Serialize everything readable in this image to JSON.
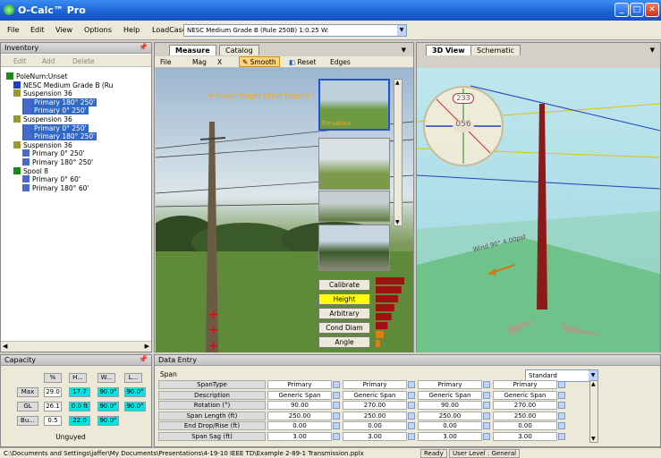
{
  "window": {
    "title": "O-Calc™ Pro"
  },
  "menubar": {
    "items": [
      "File",
      "Edit",
      "View",
      "Options",
      "Help"
    ],
    "loadcase_label": "LoadCase:",
    "loadcase_value": "NESC Medium Grade B (Rule 250B) 1:0.25 W:"
  },
  "inventory": {
    "title": "Inventory",
    "toolbar": {
      "edit": "Edit",
      "add": "Add",
      "delete": "Delete"
    },
    "tree": [
      {
        "label": "PoleNum:Unset",
        "icon": "pole-icon"
      },
      {
        "label": "NESC Medium Grade B (Ru",
        "icon": "info-icon"
      },
      {
        "label": "Suspension 36",
        "icon": "insulator-icon"
      },
      {
        "label": "Primary 180° 250'",
        "icon": "wire-icon",
        "selected": true
      },
      {
        "label": "Primary 0° 250'",
        "icon": "wire-icon",
        "selected": true
      },
      {
        "label": "Suspension 36",
        "icon": "insulator-icon"
      },
      {
        "label": "Primary 0° 250'",
        "icon": "wire-icon",
        "selected": true
      },
      {
        "label": "Primary 180° 250'",
        "icon": "wire-icon",
        "selected": true
      },
      {
        "label": "Suspension 36",
        "icon": "insulator-icon"
      },
      {
        "label": "Primary 0° 250'",
        "icon": "wire-icon"
      },
      {
        "label": "Primary 180° 250'",
        "icon": "wire-icon"
      },
      {
        "label": "Spool 8",
        "icon": "spool-icon"
      },
      {
        "label": "Primary 0° 60'",
        "icon": "wire-icon"
      },
      {
        "label": "Primary 180° 60'",
        "icon": "wire-icon"
      }
    ]
  },
  "capacity": {
    "title": "Capacity",
    "headers": [
      "%",
      "H...",
      "W...",
      "L..."
    ],
    "rows": [
      {
        "label": "Max",
        "values": [
          "29.0",
          "17.7",
          "90.0°",
          "90.0°"
        ]
      },
      {
        "label": "GL",
        "values": [
          "26.1",
          "0.0 ft",
          "90.0°",
          "90.0°"
        ]
      },
      {
        "label": "Bu...",
        "values": [
          "0.5",
          "22.0",
          "90.0°"
        ]
      }
    ],
    "footer": "Unguyed"
  },
  "measure": {
    "tabs": [
      "Measure",
      "Catalog"
    ],
    "toolbar": {
      "file": "File",
      "mag": "Mag",
      "x": "X",
      "smooth": "Smooth",
      "reset": "Reset",
      "edges": "Edges"
    },
    "install_label": "Install Height (ft) of Spool 8",
    "thumb_label": "Elevation",
    "buttons": [
      "Calibrate",
      "Height",
      "Arbitrary",
      "Cond Diam",
      "Angle"
    ],
    "active_button": "Height",
    "bar_fractions": [
      1.0,
      0.9,
      0.78,
      0.65,
      0.55,
      0.42,
      0.28,
      0.15
    ]
  },
  "view3d": {
    "tabs": [
      "3D View",
      "Schematic"
    ],
    "compass": {
      "top": "233",
      "center": "056"
    },
    "wind_label": "Wind 90° 4.00psf"
  },
  "dataentry": {
    "title": "Data Entry",
    "section": "Span",
    "preset": "Standard",
    "rows": [
      {
        "label": "SpanType",
        "values": [
          "Primary",
          "Primary",
          "Primary",
          "Primary"
        ]
      },
      {
        "label": "Description",
        "values": [
          "Generic Span",
          "Generic Span",
          "Generic Span",
          "Generic Span"
        ]
      },
      {
        "label": "Rotation (°)",
        "values": [
          "90.00",
          "270.00",
          "90.00",
          "270.00"
        ]
      },
      {
        "label": "Span Length (ft)",
        "values": [
          "250.00",
          "250.00",
          "250.00",
          "250.00"
        ]
      },
      {
        "label": "End Drop/Rise (ft)",
        "values": [
          "0.00",
          "0.00",
          "0.00",
          "0.00"
        ]
      },
      {
        "label": "Span Sag (ft)",
        "values": [
          "3.00",
          "3.00",
          "3.00",
          "3.00"
        ]
      }
    ]
  },
  "statusbar": {
    "path": "C:\\Documents and Settings\\jaffer\\My Documents\\Presentations\\4-19-10 IEEE TD\\Example 2-89-1 Transmission.pplx",
    "ready": "Ready",
    "user_level": "User Level : General"
  }
}
